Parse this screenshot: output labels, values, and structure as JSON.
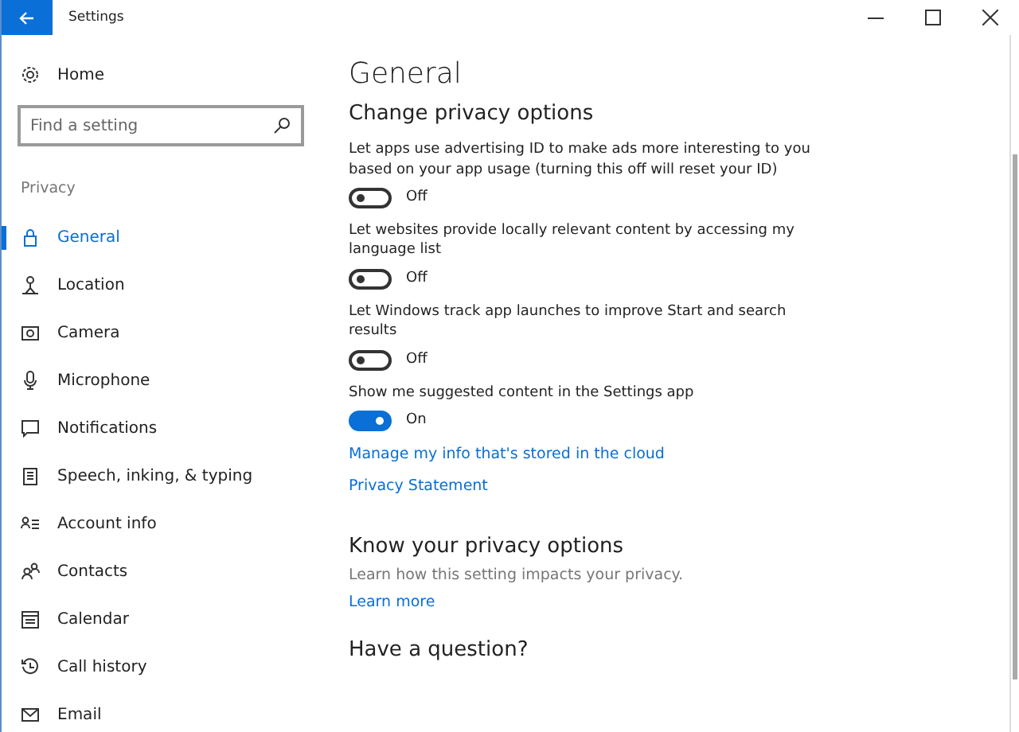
{
  "window": {
    "title": "Settings"
  },
  "sidebar": {
    "home": "Home",
    "search": {
      "placeholder": "Find a setting"
    },
    "section": "Privacy",
    "items": [
      {
        "label": "General",
        "selected": true
      },
      {
        "label": "Location",
        "selected": false
      },
      {
        "label": "Camera",
        "selected": false
      },
      {
        "label": "Microphone",
        "selected": false
      },
      {
        "label": "Notifications",
        "selected": false
      },
      {
        "label": "Speech, inking, & typing",
        "selected": false
      },
      {
        "label": "Account info",
        "selected": false
      },
      {
        "label": "Contacts",
        "selected": false
      },
      {
        "label": "Calendar",
        "selected": false
      },
      {
        "label": "Call history",
        "selected": false
      },
      {
        "label": "Email",
        "selected": false
      }
    ]
  },
  "main": {
    "title": "General",
    "section": "Change privacy options",
    "options": [
      {
        "description": "Let apps use advertising ID to make ads more interesting to you based on your app usage (turning this off will reset your ID)",
        "on": false,
        "state": "Off"
      },
      {
        "description": "Let websites provide locally relevant content by accessing my language list",
        "on": false,
        "state": "Off"
      },
      {
        "description": "Let Windows track app launches to improve Start and search results",
        "on": false,
        "state": "Off"
      },
      {
        "description": "Show me suggested content in the Settings app",
        "on": true,
        "state": "On"
      }
    ],
    "links": [
      "Manage my info that's stored in the cloud",
      "Privacy Statement"
    ],
    "know": {
      "title": "Know your privacy options",
      "text": "Learn how this setting impacts your privacy.",
      "link": "Learn more"
    },
    "question": "Have a question?"
  }
}
